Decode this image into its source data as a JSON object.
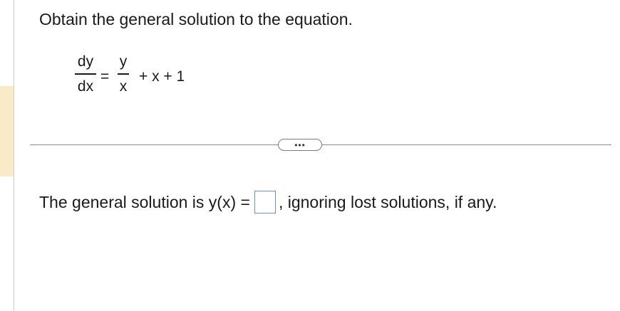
{
  "question": {
    "prompt": "Obtain the general solution to the equation."
  },
  "equation": {
    "lhs_numerator": "dy",
    "lhs_denominator": "dx",
    "equals": "=",
    "rhs_numerator": "y",
    "rhs_denominator": "x",
    "rhs_rest": "+ x + 1"
  },
  "more_button": {
    "label": "•••"
  },
  "answer": {
    "prefix": "The general solution is y(x) =",
    "input_value": "",
    "suffix": ", ignoring lost solutions, if any."
  },
  "colors": {
    "side_tab": "#faebc8",
    "answer_box_border": "#6b8fc9",
    "divider": "#8a8a8a"
  }
}
